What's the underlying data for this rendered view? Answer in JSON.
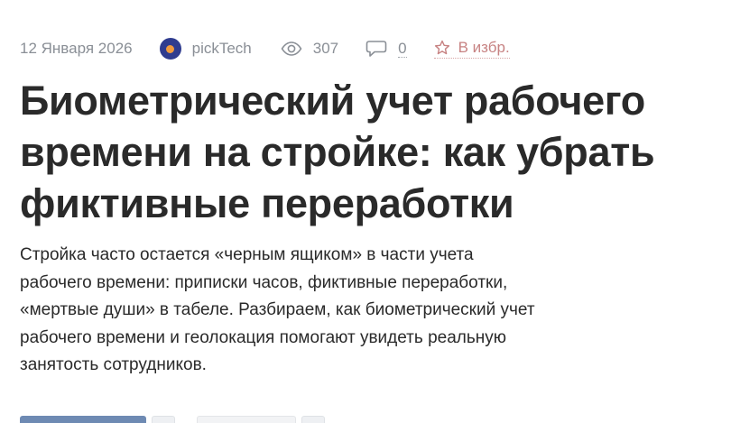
{
  "meta": {
    "date": "12 Января 2026",
    "author": "pickTech",
    "views": "307",
    "comments": "0",
    "favorite_label": "В избр."
  },
  "article": {
    "title_lines": [
      "Биометрический учет рабочего",
      "времени на стройке: как убрать",
      "фиктивные переработки"
    ],
    "lead_lines": [
      "Стройка часто остается «черным ящиком» в части учета",
      "рабочего времени: приписки часов, фиктивные переработки,",
      "«мертвые души» в табеле. Разбираем, как биометрический учет",
      "рабочего времени и геолокация помогают увидеть реальную",
      "занятость сотрудников."
    ]
  },
  "colors": {
    "title": "#2a2a2a",
    "meta": "#8a8f96",
    "favorite": "#c78282",
    "avatar_bg": "#2f3c8f",
    "avatar_dot": "#f09a3e",
    "share_button": "#6e8ab3"
  },
  "icons": {
    "views": "eye-icon",
    "comments": "speech-bubble-icon",
    "favorite": "star-outline-icon"
  }
}
